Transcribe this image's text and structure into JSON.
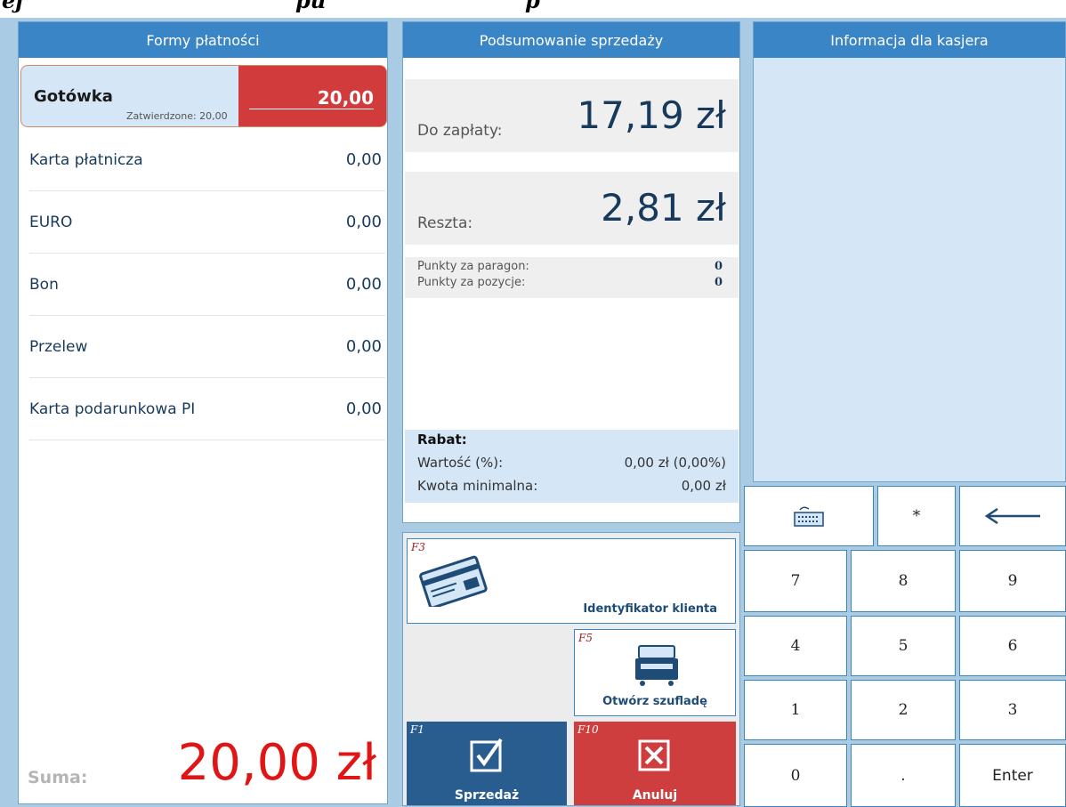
{
  "top_banner": {
    "text_left": "ej",
    "text_mid": "pu",
    "text_right": "p"
  },
  "payment_forms": {
    "header": "Formy płatności",
    "active": {
      "name": "Gotówka",
      "confirmed": "Zatwierdzone: 20,00",
      "amount": "20,00"
    },
    "items": [
      {
        "name": "Karta płatnicza",
        "amount": "0,00"
      },
      {
        "name": "EURO",
        "amount": "0,00"
      },
      {
        "name": "Bon",
        "amount": "0,00"
      },
      {
        "name": "Przelew",
        "amount": "0,00"
      },
      {
        "name": "Karta podarunkowa PI",
        "amount": "0,00"
      }
    ],
    "sum_label": "Suma:",
    "sum_value": "20,00 zł"
  },
  "summary": {
    "header": "Podsumowanie sprzedaży",
    "to_pay_label": "Do zapłaty:",
    "to_pay_value": "17,19 zł",
    "change_label": "Reszta:",
    "change_value": "2,81 zł",
    "points_receipt_label": "Punkty za paragon:",
    "points_receipt_value": "0",
    "points_items_label": "Punkty za pozycje:",
    "points_items_value": "0",
    "discount_title": "Rabat:",
    "discount_value_label": "Wartość (%):",
    "discount_value": "0,00 zł (0,00%)",
    "min_amount_label": "Kwota minimalna:",
    "min_amount_value": "0,00 zł"
  },
  "buttons": {
    "client_id": {
      "fkey": "F3",
      "label": "Identyfikator klienta"
    },
    "open_drawer": {
      "fkey": "F5",
      "label": "Otwórz szufladę"
    },
    "sell": {
      "fkey": "F1",
      "label": "Sprzedaż"
    },
    "cancel": {
      "fkey": "F10",
      "label": "Anuluj"
    }
  },
  "cashier_info": {
    "header": "Informacja dla kasjera"
  },
  "keypad": {
    "asterisk": "*",
    "k7": "7",
    "k8": "8",
    "k9": "9",
    "k4": "4",
    "k5": "5",
    "k6": "6",
    "k1": "1",
    "k2": "2",
    "k3": "3",
    "k0": "0",
    "dot": ".",
    "enter": "Enter"
  },
  "colors": {
    "header_blue": "#3a85c6",
    "amount_red": "#d23b3b",
    "sum_red": "#e01616",
    "sell_blue": "#2a5d8f",
    "cancel_red": "#cf3e3e",
    "panel_bg": "#a9cbe3"
  }
}
